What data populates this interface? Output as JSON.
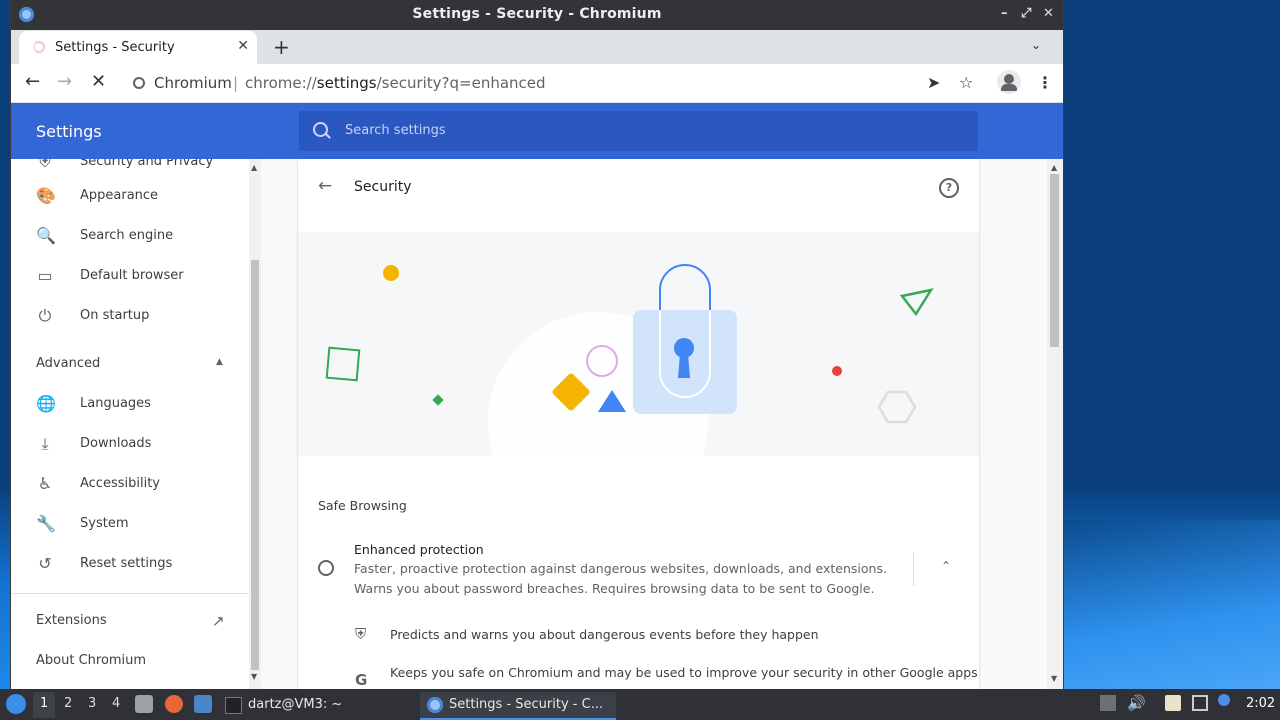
{
  "window": {
    "title": "Settings - Security - Chromium",
    "controls": [
      "–",
      "⤢",
      "✕"
    ]
  },
  "tab": {
    "label": "Settings - Security",
    "close": "✕",
    "new_tab": "+"
  },
  "omnibox": {
    "site": "Chromium",
    "separator": "|",
    "url_prefix": "chrome://",
    "url_host": "settings",
    "url_path": "/security?q=enhanced"
  },
  "settings": {
    "brand": "Settings",
    "search_placeholder": "Search settings"
  },
  "sidebar": {
    "partial_item": "Security and Privacy",
    "items": [
      {
        "label": "Appearance",
        "icon": "palette-icon",
        "glyph": "🎨"
      },
      {
        "label": "Search engine",
        "icon": "search-icon",
        "glyph": "🔍"
      },
      {
        "label": "Default browser",
        "icon": "browser-icon",
        "glyph": "▭"
      },
      {
        "label": "On startup",
        "icon": "power-icon",
        "glyph": "⏻"
      }
    ],
    "advanced_label": "Advanced",
    "advanced_items": [
      {
        "label": "Languages",
        "icon": "globe-icon",
        "glyph": "🌐"
      },
      {
        "label": "Downloads",
        "icon": "download-icon",
        "glyph": "⤓"
      },
      {
        "label": "Accessibility",
        "icon": "accessibility-icon",
        "glyph": "♿"
      },
      {
        "label": "System",
        "icon": "wrench-icon",
        "glyph": "🔧"
      },
      {
        "label": "Reset settings",
        "icon": "history-icon",
        "glyph": "↺"
      }
    ],
    "extensions_label": "Extensions",
    "about_label": "About Chromium"
  },
  "page": {
    "title": "Security",
    "help": "?",
    "section_title": "Safe Browsing",
    "option": {
      "title": "Enhanced protection",
      "description": "Faster, proactive protection against dangerous websites, downloads, and extensions. Warns you about password breaches. Requires browsing data to be sent to Google."
    },
    "bullets": [
      {
        "text": "Predicts and warns you about dangerous events before they happen",
        "icon": "shield-icon",
        "glyph": "⛨"
      },
      {
        "text": "Keeps you safe on Chromium and may be used to improve your security in other Google apps",
        "icon": "google-icon",
        "glyph": "G"
      }
    ]
  },
  "taskbar": {
    "workspaces": [
      "1",
      "2",
      "3",
      "4"
    ],
    "terminal_task": "dartz@VM3: ~",
    "browser_task": "Settings - Security - C...",
    "clock": "2:02"
  },
  "colors": {
    "accent": "#3367d6",
    "titlebar": "#333438",
    "taskbar": "#2f3136"
  }
}
